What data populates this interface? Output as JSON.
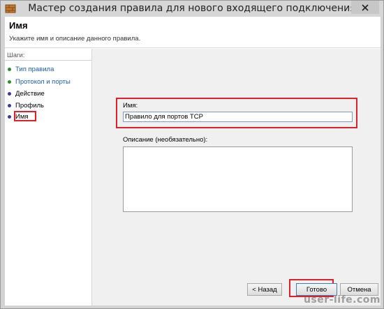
{
  "window": {
    "title": "Мастер создания правила для нового входящего подключения",
    "app_icon": "firewall-rule-icon",
    "close_icon": "close-icon"
  },
  "header": {
    "title": "Имя",
    "description": "Укажите имя и описание данного правила."
  },
  "sidebar": {
    "title": "Шаги:",
    "steps": [
      {
        "label": "Тип правила",
        "state": "done"
      },
      {
        "label": "Протокол и порты",
        "state": "done"
      },
      {
        "label": "Действие",
        "state": "pending"
      },
      {
        "label": "Профиль",
        "state": "pending"
      },
      {
        "label": "Имя",
        "state": "current"
      }
    ]
  },
  "form": {
    "name_label": "Имя:",
    "name_value": "Правило для портов TCP",
    "description_label": "Описание (необязательно):",
    "description_value": ""
  },
  "buttons": {
    "back": "< Назад",
    "finish": "Готово",
    "cancel": "Отмена"
  },
  "watermark": "user-life.com",
  "colors": {
    "highlight": "#e0202a",
    "done_dot": "#2e8b2e",
    "pending_dot": "#3a3a9a",
    "link": "#1a5fa8"
  }
}
